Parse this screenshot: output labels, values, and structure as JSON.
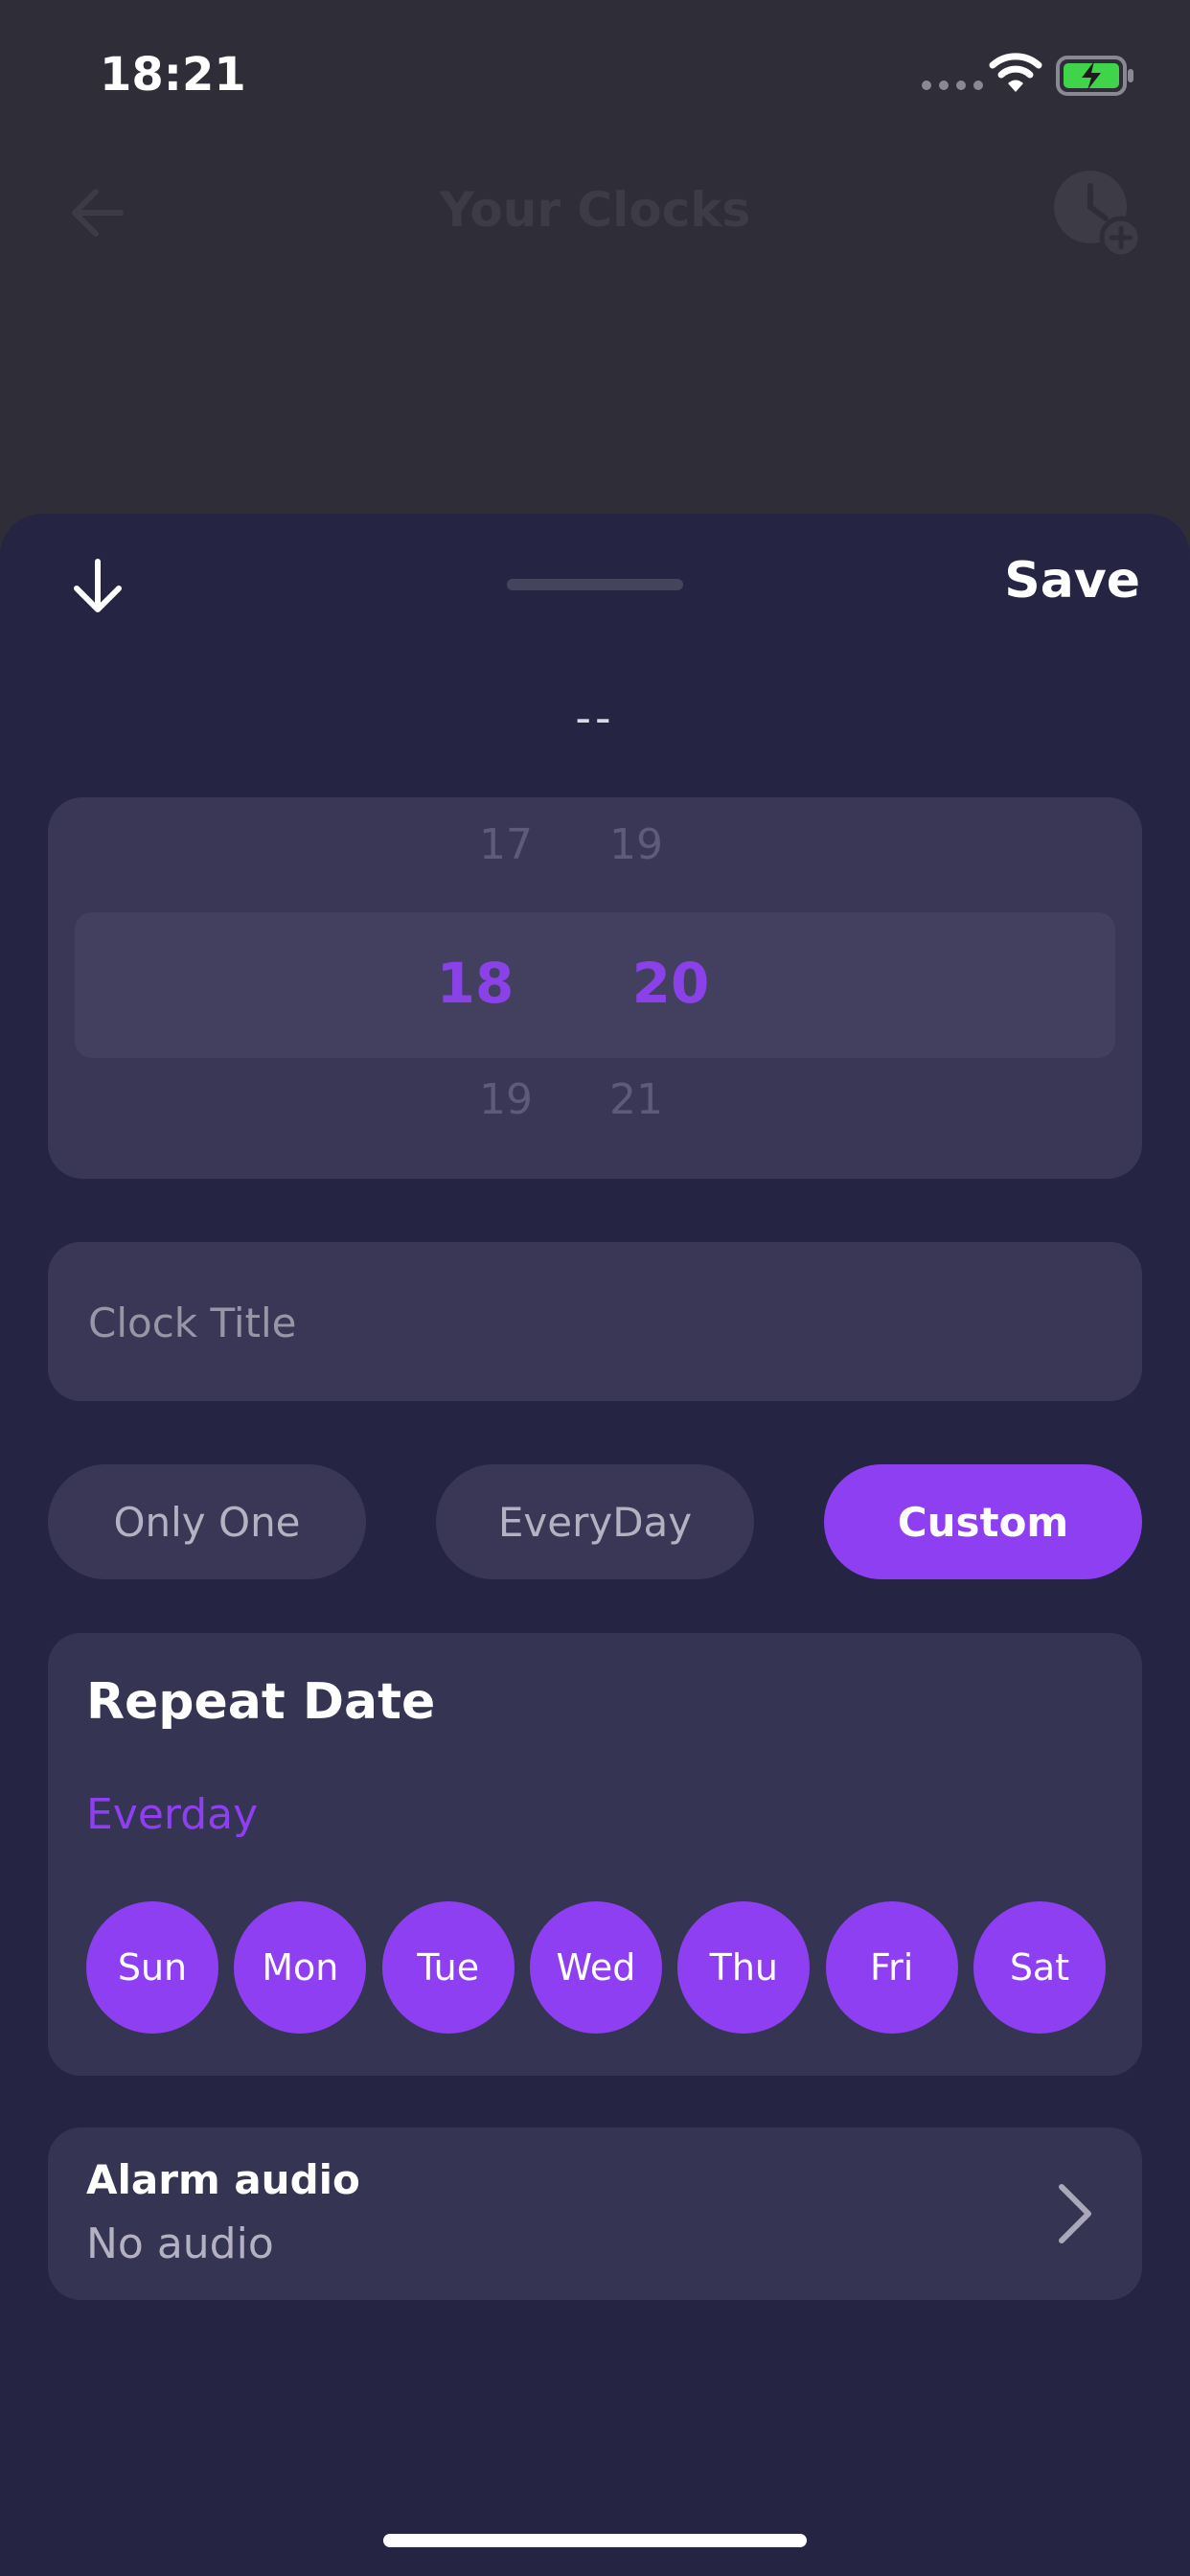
{
  "status_bar": {
    "time": "18:21"
  },
  "background_screen": {
    "title": "Your Clocks"
  },
  "sheet": {
    "save_label": "Save",
    "time_readout": "--",
    "picker": {
      "hours": {
        "above": "17",
        "selected": "18",
        "below": "19"
      },
      "minutes": {
        "above": "19",
        "selected": "20",
        "below": "21"
      }
    },
    "clock_title": {
      "placeholder": "Clock Title",
      "value": ""
    },
    "repeat_options": [
      {
        "label": "Only One",
        "selected": false
      },
      {
        "label": "EveryDay",
        "selected": false
      },
      {
        "label": "Custom",
        "selected": true
      }
    ],
    "repeat_date": {
      "title": "Repeat Date",
      "summary": "Everday",
      "days": [
        "Sun",
        "Mon",
        "Tue",
        "Wed",
        "Thu",
        "Fri",
        "Sat"
      ]
    },
    "alarm_audio": {
      "label": "Alarm audio",
      "value": "No audio"
    }
  },
  "colors": {
    "accent": "#8e3ff2",
    "sheet_background": "#262443",
    "card_background": "#363453"
  },
  "icons": [
    "wifi-icon",
    "battery-charging-icon",
    "back-arrow-icon",
    "add-clock-icon",
    "arrow-down-icon",
    "chevron-right-icon"
  ]
}
